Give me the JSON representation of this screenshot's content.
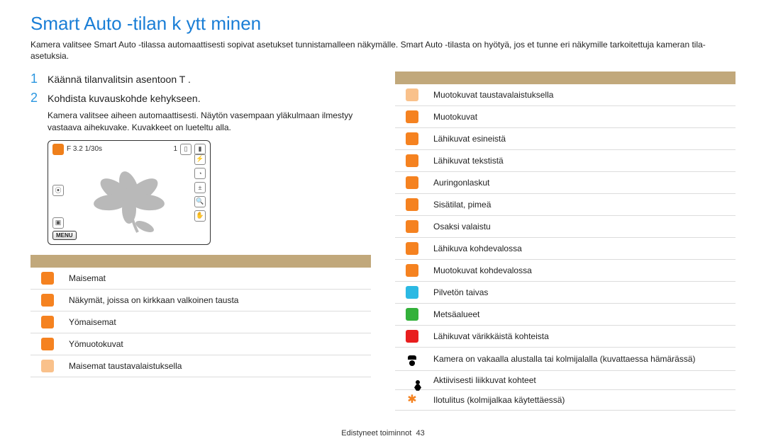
{
  "title": "Smart Auto -tilan k ytt minen",
  "intro": "Kamera valitsee Smart Auto -tilassa automaattisesti sopivat asetukset tunnistamalleen näkymälle. Smart Auto -tilasta on hyötyä, jos et tunne eri näkymille tarkoitettuja kameran tila-asetuksia.",
  "steps": {
    "one": {
      "num": "1",
      "text": "Käännä tilanvalitsin asentoon T            ."
    },
    "two": {
      "num": "2",
      "text": "Kohdista kuvauskohde kehykseen.",
      "sub": "Kamera valitsee aiheen automaattisesti. Näytön vasempaan yläkulmaan ilmestyy vastaava aihekuvake. Kuvakkeet on lueteltu alla."
    }
  },
  "camera": {
    "info_left": "F 3.2  1/30s",
    "info_right_single": "1",
    "menu": "MENU"
  },
  "left_table": [
    {
      "icon": "ic-orange",
      "label": "Maisemat"
    },
    {
      "icon": "ic-orange",
      "label": "Näkymät, joissa on kirkkaan valkoinen tausta"
    },
    {
      "icon": "ic-orange",
      "label": "Yömaisemat"
    },
    {
      "icon": "ic-orange",
      "label": "Yömuotokuvat"
    },
    {
      "icon": "ic-pale",
      "label": "Maisemat taustavalaistuksella"
    }
  ],
  "right_table": [
    {
      "icon": "ic-pale",
      "label": "Muotokuvat taustavalaistuksella"
    },
    {
      "icon": "ic-orange",
      "label": "Muotokuvat"
    },
    {
      "icon": "ic-orange",
      "label": "Lähikuvat esineistä"
    },
    {
      "icon": "ic-orange",
      "label": "Lähikuvat tekstistä"
    },
    {
      "icon": "ic-orange",
      "label": "Auringonlaskut"
    },
    {
      "icon": "ic-orange",
      "label": "Sisätilat, pimeä"
    },
    {
      "icon": "ic-orange",
      "label": "Osaksi valaistu"
    },
    {
      "icon": "ic-orange",
      "label": "Lähikuva kohdevalossa"
    },
    {
      "icon": "ic-orange",
      "label": "Muotokuvat kohdevalossa"
    },
    {
      "icon": "ic-cyan",
      "label": "Pilvetön taivas"
    },
    {
      "icon": "ic-green",
      "label": "Metsäalueet"
    },
    {
      "icon": "ic-red",
      "label": "Lähikuvat värikkäistä kohteista"
    },
    {
      "icon": "ic-person",
      "label": "Kamera on vakaalla alustalla tai kolmijalalla (kuvattaessa hämärässä)"
    },
    {
      "icon": "ic-run",
      "label": "Aktiivisesti liikkuvat kohteet"
    },
    {
      "icon": "ic-burst",
      "label": "Ilotulitus (kolmijalkaa käytettäessä)"
    }
  ],
  "footer": {
    "section": "Edistyneet toiminnot",
    "page": "43"
  }
}
